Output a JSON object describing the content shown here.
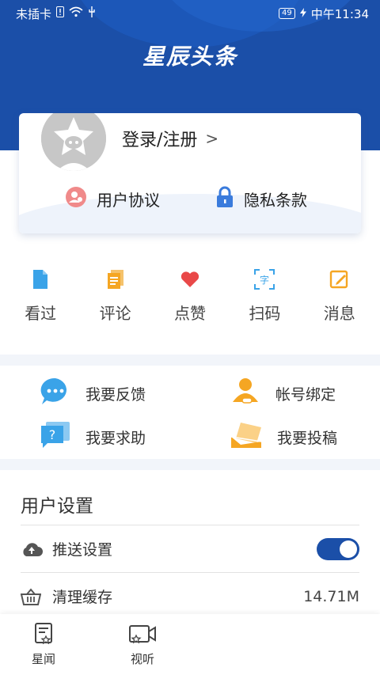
{
  "status_bar": {
    "carrier": "未插卡",
    "battery": "49",
    "time": "中午11:34"
  },
  "app_title": "星辰头条",
  "profile": {
    "login_label": "登录/注册",
    "chevron": ">"
  },
  "agreements": {
    "user_agreement": "用户协议",
    "privacy": "隐私条款"
  },
  "quick_actions": [
    {
      "label": "看过",
      "icon": "document-icon"
    },
    {
      "label": "评论",
      "icon": "comment-icon"
    },
    {
      "label": "点赞",
      "icon": "heart-icon"
    },
    {
      "label": "扫码",
      "icon": "scan-icon"
    },
    {
      "label": "消息",
      "icon": "message-icon"
    }
  ],
  "services": [
    {
      "label": "我要反馈",
      "icon": "feedback-icon"
    },
    {
      "label": "帐号绑定",
      "icon": "account-bind-icon"
    },
    {
      "label": "我要求助",
      "icon": "help-icon"
    },
    {
      "label": "我要投稿",
      "icon": "submit-icon"
    }
  ],
  "settings": {
    "title": "用户设置",
    "push_label": "推送设置",
    "push_enabled": true,
    "cache_label": "清理缓存",
    "cache_size": "14.71M"
  },
  "tabbar": {
    "tab1": "星闻",
    "tab2": "视听"
  },
  "colors": {
    "brand_blue": "#1b4fa8",
    "orange": "#f5a623",
    "light_blue": "#3aa3e8",
    "red": "#e94848"
  }
}
